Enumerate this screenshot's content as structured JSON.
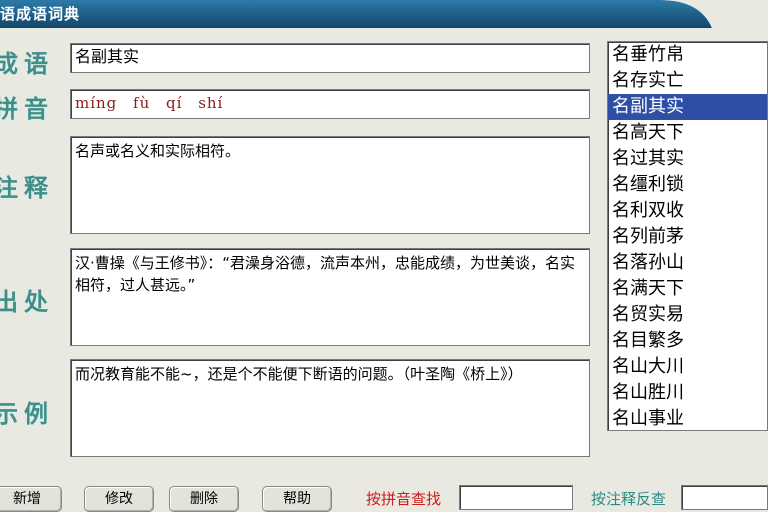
{
  "app": {
    "title": "汉语成语词典"
  },
  "labels": {
    "idiom": "成语",
    "pinyin": "拼音",
    "definition": "注释",
    "source": "出处",
    "example": "示例"
  },
  "entry": {
    "idiom": "名副其实",
    "pinyin": "míng  fù  qí  shí",
    "definition": "名声或名义和实际相符。",
    "source": "汉·曹操《与王修书》：“君澡身浴德，流声本州，忠能成绩，为世美谈，名实相符，过人甚远。”",
    "example": "而况教育能不能~，还是个不能便下断语的问题。（叶圣陶《桥上》）"
  },
  "idiom_list": {
    "items": [
      "名垂竹帛",
      "名存实亡",
      "名副其实",
      "名高天下",
      "名过其实",
      "名缰利锁",
      "名利双收",
      "名列前茅",
      "名落孙山",
      "名满天下",
      "名贸实易",
      "名目繁多",
      "名山大川",
      "名山胜川",
      "名山事业"
    ],
    "selected_index": 2
  },
  "buttons": {
    "add": "新增",
    "edit": "修改",
    "delete": "删除",
    "help": "帮助"
  },
  "search": {
    "by_pinyin_label": "按拼音查找",
    "by_pinyin_value": "",
    "by_definition_label": "按注释反查",
    "by_definition_value": ""
  },
  "colors": {
    "titlebar": "#1f5f87",
    "label_teal": "#3f8e8a",
    "selection": "#2f4ea5",
    "pinyin_text": "#8b1a1a",
    "search_red": "#d11a1a",
    "search_teal": "#2a8a86"
  }
}
